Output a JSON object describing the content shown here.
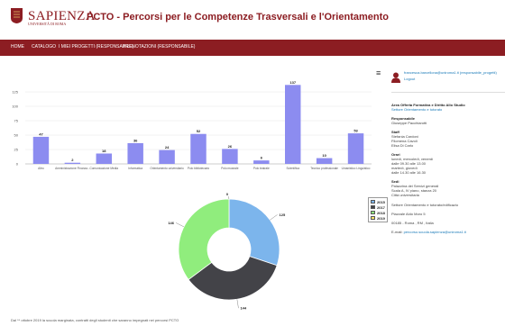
{
  "header": {
    "logo_main": "SAPIENZA",
    "logo_sub": "UNIVERSITÀ DI ROMA",
    "title": "PCTO - Percorsi per le Competenze Trasversali e l'Orientamento"
  },
  "nav": {
    "items": [
      {
        "label": "HOME"
      },
      {
        "label": "CATALOGO"
      },
      {
        "label": "I MIEI PROGETTI (RESPONSABILE)"
      },
      {
        "label": "PRENOTAZIONI (RESPONSABILE)"
      }
    ]
  },
  "chart_menu": {
    "icon": "hamburger-icon",
    "label": "≡"
  },
  "chart_data": [
    {
      "type": "bar",
      "categories": [
        "Altro",
        "Amministrazione Finanza...",
        "Comunicazione Media",
        "Informatica",
        "Orientamento universitario",
        "Polo bibliotecario",
        "Polo museale",
        "Polo teatrale",
        "Scientifica",
        "Tecnico professionale",
        "Umanistico Linguistico"
      ],
      "values": [
        47,
        2,
        18,
        36,
        24,
        52,
        26,
        6,
        137,
        10,
        53
      ],
      "ylim": [
        0,
        150
      ],
      "yticks": [
        0,
        25,
        50,
        75,
        100,
        125
      ],
      "color": "#8c8cf0"
    },
    {
      "type": "pie",
      "labels": [
        "2015",
        "2017",
        "2018",
        "2019"
      ],
      "values": [
        125,
        0,
        0,
        146
      ],
      "slice_values": [
        125,
        144,
        146
      ],
      "slice_colors": [
        "#7cb5ec",
        "#434348",
        "#90ed7d"
      ],
      "legend": [
        {
          "label": "2015",
          "color": "#7cb5ec"
        },
        {
          "label": "2017",
          "color": "#434348"
        },
        {
          "label": "2018",
          "color": "#90ed7d"
        },
        {
          "label": "2019",
          "color": "#f7e46b"
        }
      ]
    }
  ],
  "footnote": "Dal ** ottobre 2019 la scuola marginata, contratti degli studenti che saranno impegnati nei percorsi PCTO",
  "sidebar": {
    "email": "francesca.barcellona@uniroma1.it (responsabile_progetti)",
    "logout": "Logout",
    "area_title": "Area Offerta Formativa e Diritto Allo Studio",
    "area_sub": "Settore Orientamento e tutorato",
    "responsabile_label": "Responsabile",
    "responsabile_name": "Giuseppe Pacchiarotti",
    "staff_label": "Staff",
    "staff": [
      "Stefania Cardoni",
      "Filomena Cavoli",
      "Elisa Di Carlo"
    ],
    "orari_label": "Orari",
    "orari": [
      "lunedì, mercoledì, venerdì",
      "dalle 09.30 alle 13.00",
      "martedì, giovedì",
      "dalle 14.30 alle 16.30"
    ],
    "sede_label": "Sedi",
    "sede": [
      "Palazzina dei Servizi generali",
      "Scala A, IV piano, stanza 20",
      "Città universitaria"
    ],
    "settore": "Settore Orientamento e tutorato/edificazio",
    "address1": "Piazzale Aldo Moro 5",
    "address2": "00185 - Roma , RM , Italia",
    "email_label": "E-mail:",
    "email_value": "percorso.scuola.sapienza@uniroma1.it"
  }
}
